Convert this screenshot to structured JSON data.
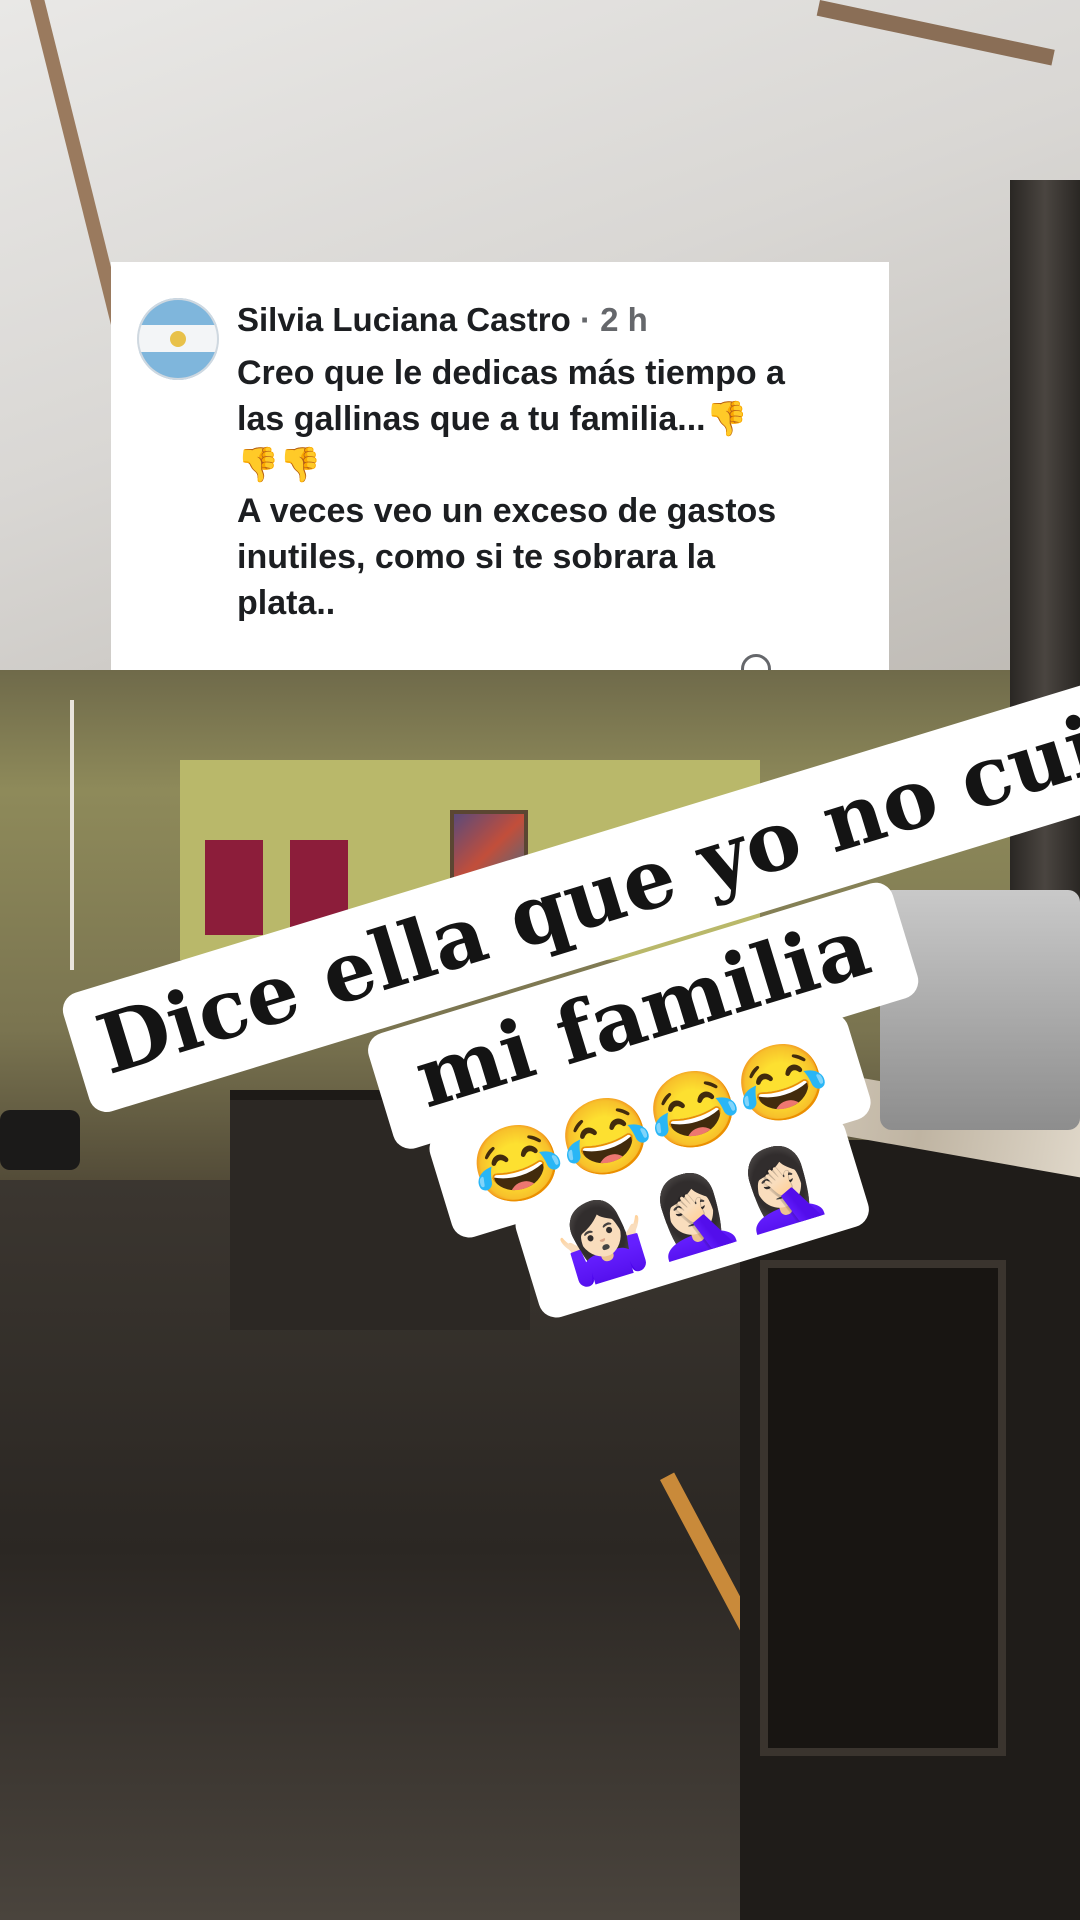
{
  "comment": {
    "author": "Silvia Luciana Castro",
    "separator": "·",
    "time": "2 h",
    "lines": [
      "Creo que le dedicas más tiempo a",
      "las gallinas que a tu familia...👎",
      "👎👎",
      "A veces veo un exceso de gastos",
      "inutiles, como si te sobrara la",
      "plata.."
    ]
  },
  "sticker": {
    "line1": "Dice ella que yo no cuido a",
    "line2": "mi familia",
    "line3": "😂😂😂😂",
    "line4": "🤷🏻‍♀️🤦🏻‍♀️🤦🏻‍♀️"
  },
  "avatar": {
    "icon": "argentina-flag-avatar",
    "colors": {
      "light_blue": "#7fb6dc",
      "white": "#f3f5f7",
      "sun": "#e8c14a"
    }
  },
  "colors": {
    "card_background": "#ffffff",
    "author_text": "#1c1e21",
    "meta_text": "#65676b",
    "sticker_background": "#ffffff",
    "sticker_text": "#141414"
  }
}
